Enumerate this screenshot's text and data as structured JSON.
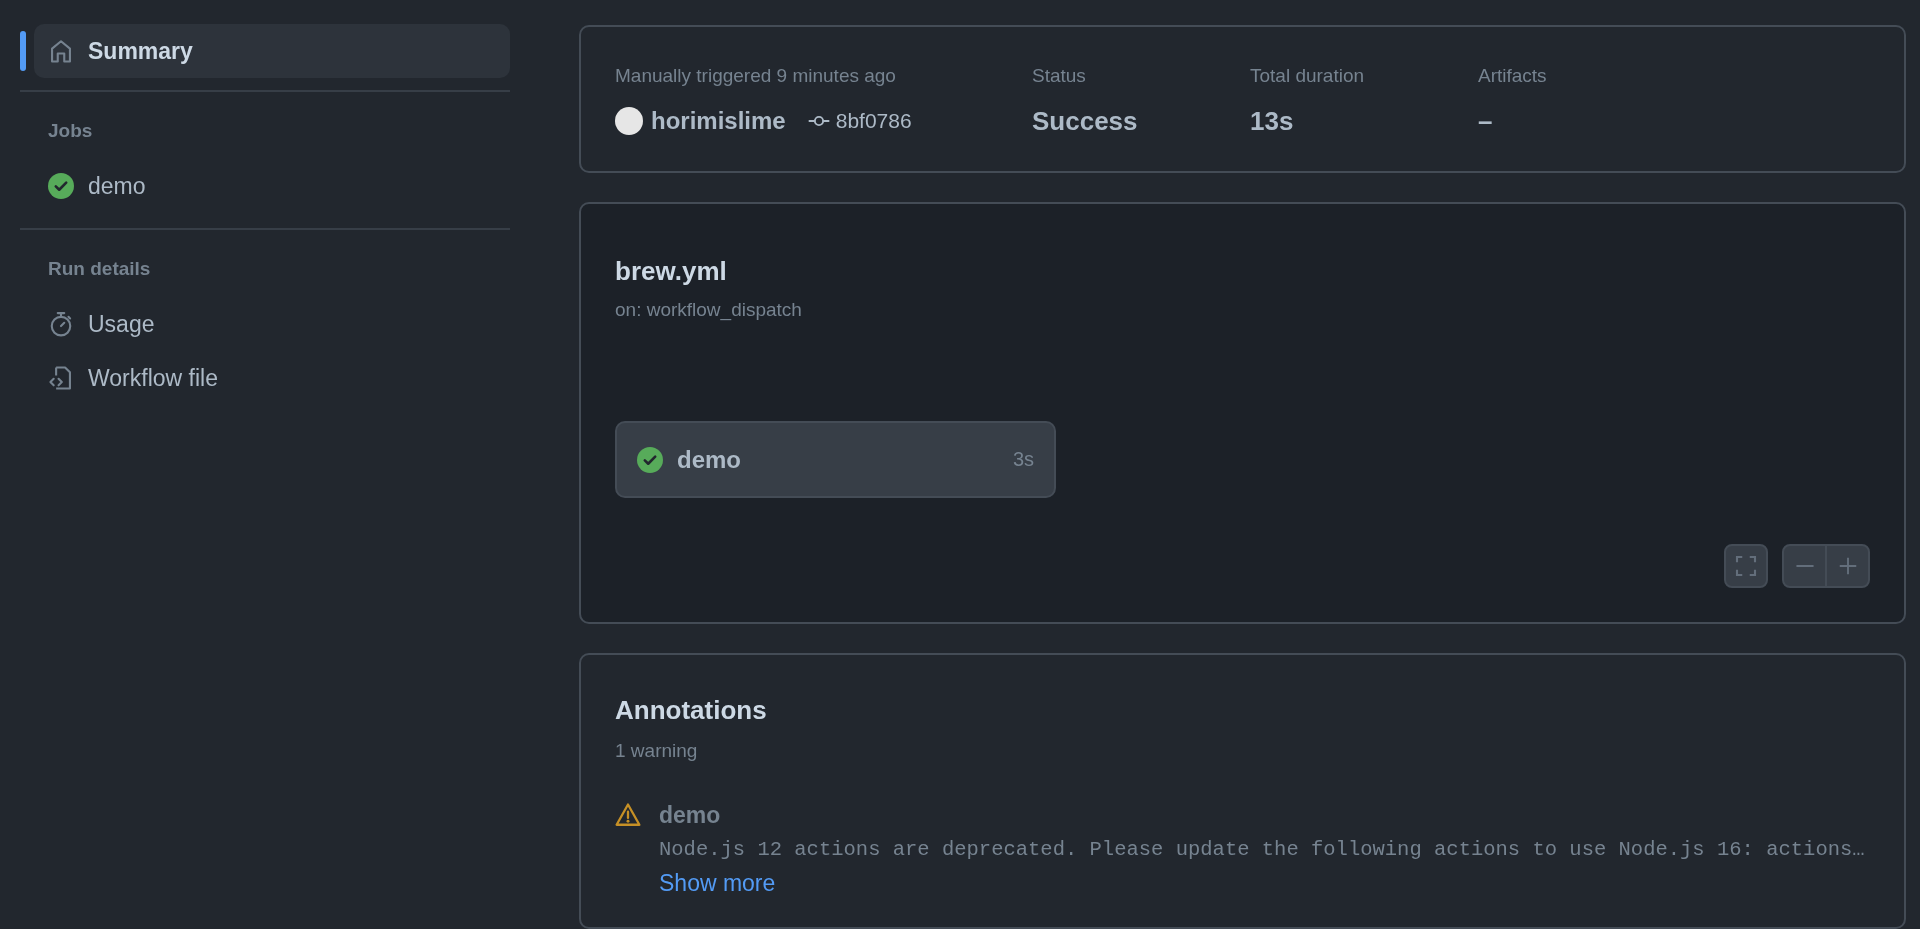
{
  "sidebar": {
    "items": [
      {
        "label": "Summary",
        "kind": "home",
        "selected": true
      }
    ],
    "sections": [
      {
        "title": "Jobs",
        "items": [
          {
            "label": "demo",
            "kind": "success",
            "selected": false
          }
        ]
      },
      {
        "title": "Run details",
        "items": [
          {
            "label": "Usage",
            "kind": "usage",
            "selected": false
          },
          {
            "label": "Workflow file",
            "kind": "file",
            "selected": false
          }
        ]
      }
    ]
  },
  "run_summary": {
    "trigger": "Manually triggered 9 minutes ago",
    "actor": "horimislime",
    "commit": "8bf0786",
    "stats": [
      {
        "label": "Status",
        "value": "Success"
      },
      {
        "label": "Total duration",
        "value": "13s"
      },
      {
        "label": "Artifacts",
        "value": "–"
      }
    ]
  },
  "workflow": {
    "file": "brew.yml",
    "trigger": "on: workflow_dispatch",
    "jobs": [
      {
        "name": "demo",
        "duration": "3s",
        "kind": "success"
      }
    ]
  },
  "annotations": {
    "title": "Annotations",
    "count": "1 warning",
    "items": [
      {
        "kind": "warning",
        "job": "demo",
        "message": "Node.js 12 actions are deprecated. Please update the following actions to use Node.js 16: actions…",
        "link": "Show more"
      }
    ]
  }
}
